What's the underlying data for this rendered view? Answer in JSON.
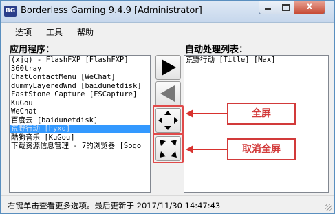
{
  "window": {
    "icon_text": "BG",
    "title": "Borderless Gaming 9.4.9 [Administrator]",
    "controls": {
      "minimize": "minimize",
      "maximize": "maximize",
      "close": "x"
    }
  },
  "menu": {
    "options": "选项",
    "tools": "工具",
    "help": "帮助"
  },
  "left_panel": {
    "label": "应用程序：",
    "items": [
      "(xjq) - FlashFXP [FlashFXP]",
      "360tray",
      "ChatContactMenu [WeChat]",
      "dummyLayeredWnd [baidunetdisk]",
      "FastStone Capture [FSCapture]",
      "KuGou",
      "WeChat",
      "百度云 [baidunetdisk]",
      "荒野行动 [hyxd]",
      "酷狗音乐 [KuGou]",
      "下载资源信息管理 - 7的浏览器 [Sogo"
    ],
    "selected_index": 8
  },
  "right_panel": {
    "label": "自动处理列表：",
    "items": [
      "荒野行动 [Title] [Max]"
    ]
  },
  "buttons": {
    "add": "play-right-icon",
    "remove": "play-left-icon",
    "fullscreen": "expand-arrows-icon",
    "cancel_fullscreen": "collapse-arrows-icon"
  },
  "annotations": {
    "fullscreen": "全屏",
    "cancel_fullscreen": "取消全屏",
    "color": "#d23a3a"
  },
  "status": {
    "text": "右键单击查看更多选项。最后更新于 2017/11/30 14:47:43"
  }
}
